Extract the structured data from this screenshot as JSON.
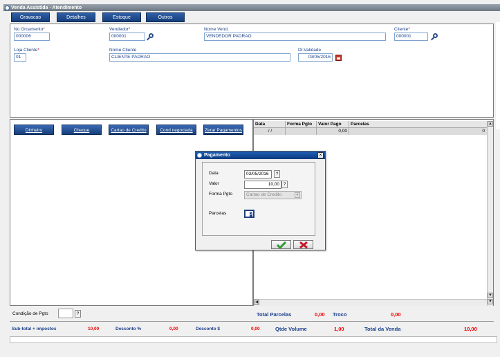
{
  "window": {
    "title": "Venda Assistida - Atendimento"
  },
  "toolbar": {
    "buttons": [
      "Gravacao",
      "Detalhes",
      "Estoque",
      "Outros"
    ]
  },
  "header": {
    "orcamento": {
      "label": "No Orcamento",
      "value": "000006"
    },
    "vendedor": {
      "label": "Vendedor",
      "value": "000001"
    },
    "nome_vend": {
      "label": "Nome Vend.",
      "value": "VENDEDOR PADRAO"
    },
    "cliente": {
      "label": "Cliente",
      "value": "000001"
    },
    "loja_cliente": {
      "label": "Loja Cliente",
      "value": "01"
    },
    "nome_cliente": {
      "label": "Nome Cliente",
      "value": "CLIENTE PADRAO"
    },
    "dt_validade": {
      "label": "Dt.Validade",
      "value": "03/05/2016"
    }
  },
  "payment_buttons": [
    "Dinheiro",
    "Cheque",
    "Cartao de Credito",
    "Cond negociada",
    "Zerar Pagamentos"
  ],
  "grid": {
    "columns": [
      "Data",
      "Forma Pgto",
      "Valor Pago",
      "Parcelas"
    ],
    "row": {
      "data": "/ /",
      "forma": "",
      "valor": "0,00",
      "parcelas": "",
      "extra": "0"
    }
  },
  "condicao": {
    "label": "Condição de Pgto",
    "value": "",
    "btn": "?"
  },
  "totals": {
    "total_parcelas_label": "Total Parcelas",
    "total_parcelas": "0,00",
    "troco_label": "Troco",
    "troco": "0,00"
  },
  "bottom": {
    "subtotal_label": "Sub-total + impostos",
    "subtotal": "10,00",
    "desc_pct_label": "Desconto %",
    "desc_pct": "0,00",
    "desc_val_label": "Desconto $",
    "desc_val": "0,00",
    "qtde_label": "Qtde Volume",
    "qtde": "1,00",
    "total_label": "Total da Venda",
    "total": "10,00"
  },
  "dialog": {
    "title": "Pagamento",
    "data_label": "Data",
    "data_value": "03/05/2016",
    "valor_label": "Valor",
    "valor_value": "10,00",
    "forma_label": "Forma Pgto",
    "forma_value": "Cartao de Credito",
    "parcelas_label": "Parcelas",
    "parcelas_value": "2",
    "q": "?"
  },
  "colors": {
    "accent": "#163e7a",
    "label": "#1a3f8a",
    "value_red": "#e00000"
  }
}
